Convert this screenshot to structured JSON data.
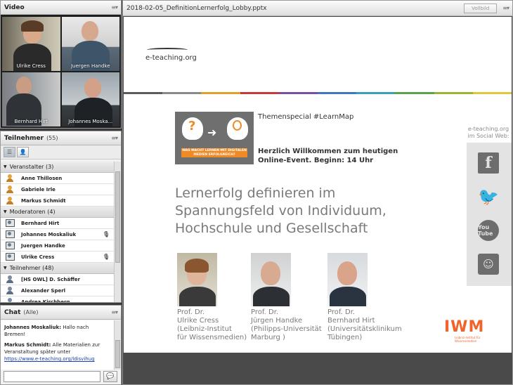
{
  "video": {
    "title": "Video",
    "participants": [
      "Ulrike Cress",
      "Juergen Handke",
      "Bernhard Hirt",
      "Johannes Moska..."
    ]
  },
  "participants_panel": {
    "title": "Teilnehmer",
    "count": "(55)",
    "groups": [
      {
        "label": "Veranstalter (3)",
        "role": "host",
        "members": [
          "Anne Thillosen",
          "Gabriele Irle",
          "Markus Schmidt"
        ]
      },
      {
        "label": "Moderatoren (4)",
        "role": "mod",
        "members": [
          "Bernhard Hirt",
          "Johannes Moskaliuk",
          "Juergen Handke",
          "Ulrike Cress"
        ]
      },
      {
        "label": "Teilnehmer (48)",
        "role": "att",
        "members": [
          "[HS OWL] D. Schäffer",
          "Alexander Sperl",
          "Andrea Kirchberg"
        ]
      }
    ]
  },
  "chat": {
    "title": "Chat",
    "scope": "(Alle)",
    "messages": [
      {
        "sender": "Johannes Moskaliuk:",
        "text": "Hallo nach Bremen!"
      },
      {
        "sender": "Markus Schmidt:",
        "text": "Alle Materialien zur Veranstaltung später unter",
        "link": "https://www.e-teaching.org/ldisvihug"
      }
    ],
    "send_icon": "speech-bubble-icon"
  },
  "presentation": {
    "filename": "2018-02-05_DefinitionLernerfolg_Lobby.pptx",
    "fullscreen_label": "Vollbild",
    "slide": {
      "logo": "e-teaching.org",
      "themenspecial": "Themenspecial #LearnMap",
      "banner_text": "WAS MACHT LERNEN MIT DIGITALEN MEDIEN ERFOLGREICH?",
      "welcome_line1": "Herzlich Willkommen zum heutigen",
      "welcome_line2": "Online-Event. Beginn: 14 Uhr",
      "title_lines": [
        "Lernerfolg definieren im",
        "Spannungsfeld von Individuum,",
        "Hochschule und Gesellschaft"
      ],
      "speakers": [
        {
          "lines": [
            "Prof. Dr.",
            "Ulrike Cress",
            "(Leibniz-Institut",
            "für Wissensmedien)"
          ]
        },
        {
          "lines": [
            "Prof. Dr.",
            "Jürgen Handke",
            "(Philipps-Universität",
            "Marburg )"
          ]
        },
        {
          "lines": [
            "Prof. Dr.",
            "Bernhard Hirt",
            "(Universitätsklinikum",
            "Tübingen)"
          ]
        }
      ],
      "social_label_1": "e-teaching.org",
      "social_label_2": "im Social Web:",
      "social": [
        "facebook-icon",
        "twitter-icon",
        "youtube-icon",
        "slideshare-icon"
      ],
      "youtube_text": "You Tube",
      "iwm_logo": "IWM",
      "iwm_sub_1": "Leibniz-Institut für",
      "iwm_sub_2": "Wissensmedien",
      "colorbar": [
        "#5b5b5b",
        "#8a8a8a",
        "#e0a02a",
        "#c43a3a",
        "#7b4fa0",
        "#3f78c2",
        "#3aa0b5",
        "#5aa34a",
        "#9ab43a",
        "#e0c83a"
      ]
    }
  }
}
